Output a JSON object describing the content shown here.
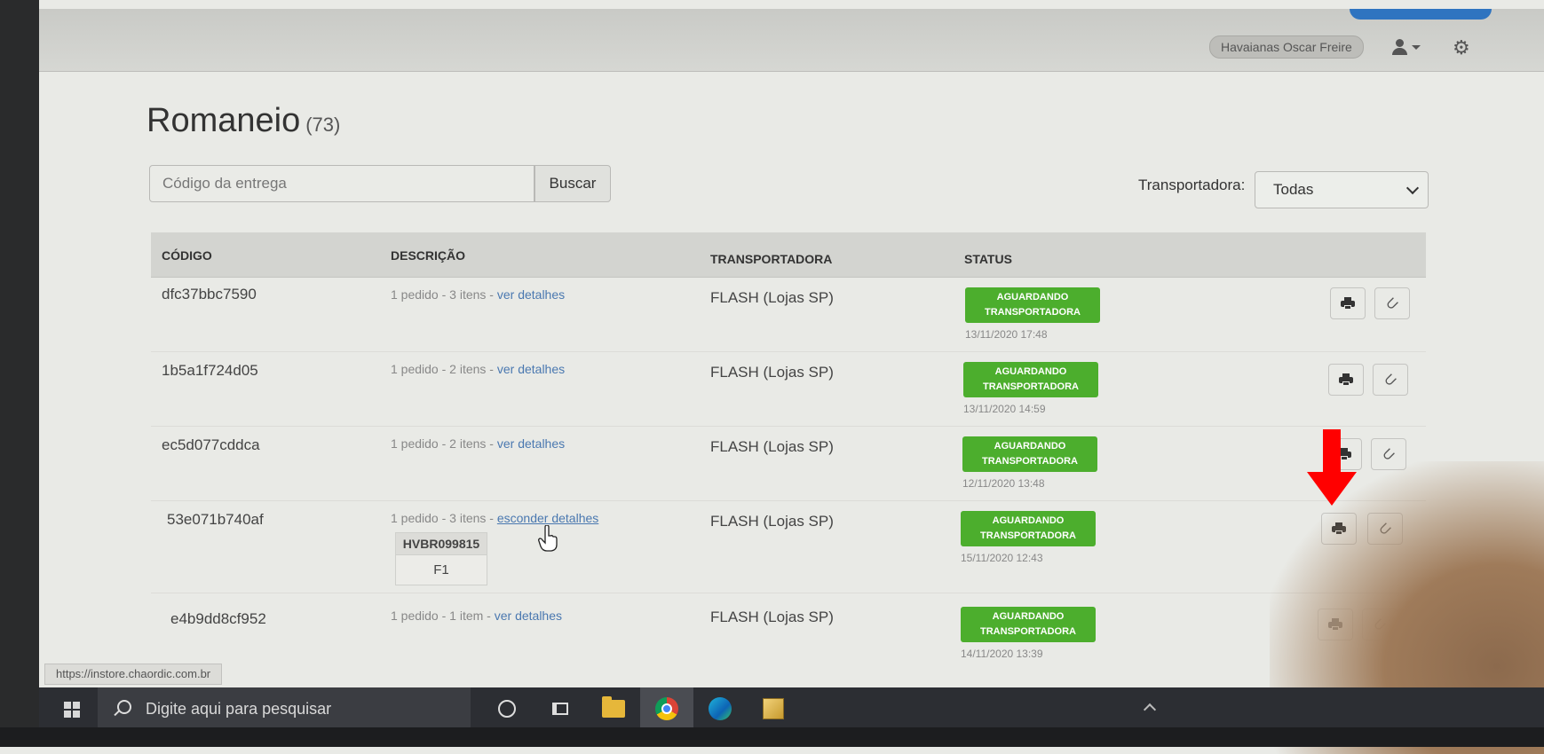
{
  "header": {
    "store_name": "Havaianas Oscar Freire",
    "user_icon": "user-icon",
    "settings_icon": "gear-icon"
  },
  "page": {
    "title": "Romaneio",
    "count": "(73)"
  },
  "search": {
    "placeholder": "Código da entrega",
    "button_label": "Buscar"
  },
  "filter": {
    "label": "Transportadora:",
    "selected": "Todas"
  },
  "table": {
    "columns": [
      "CÓDIGO",
      "DESCRIÇÃO",
      "TRANSPORTADORA",
      "STATUS"
    ],
    "rows": [
      {
        "code": "dfc37bbc7590",
        "desc": "1 pedido - 3 itens - ",
        "link": "ver detalhes",
        "carrier": "FLASH (Lojas SP)",
        "status_line1": "AGUARDANDO",
        "status_line2": "TRANSPORTADORA",
        "date": "13/11/2020 17:48"
      },
      {
        "code": "1b5a1f724d05",
        "desc": "1 pedido - 2 itens - ",
        "link": "ver detalhes",
        "carrier": "FLASH (Lojas SP)",
        "status_line1": "AGUARDANDO",
        "status_line2": "TRANSPORTADORA",
        "date": "13/11/2020 14:59"
      },
      {
        "code": "ec5d077cddca",
        "desc": "1 pedido - 2 itens - ",
        "link": "ver detalhes",
        "carrier": "FLASH (Lojas SP)",
        "status_line1": "AGUARDANDO",
        "status_line2": "TRANSPORTADORA",
        "date": "12/11/2020 13:48"
      },
      {
        "code": "53e071b740af",
        "desc": "1 pedido - 3 itens - ",
        "link": "esconder detalhes",
        "carrier": "FLASH (Lojas SP)",
        "status_line1": "AGUARDANDO",
        "status_line2": "TRANSPORTADORA",
        "date": "15/11/2020 12:43",
        "detail_code": "HVBR099815",
        "detail_sub": "F1"
      },
      {
        "code": "e4b9dd8cf952",
        "desc": "1 pedido - 1 item - ",
        "link": "ver detalhes",
        "carrier": "FLASH (Lojas SP)",
        "status_line1": "AGUARDANDO",
        "status_line2": "TRANSPORTADORA",
        "date": "14/11/2020 13:39"
      }
    ]
  },
  "statusbar": {
    "url": "https://instore.chaordic.com.br"
  },
  "taskbar": {
    "search_placeholder": "Digite aqui para pesquisar"
  },
  "colors": {
    "status_green": "#4cae2d",
    "link_blue": "#4a78b0",
    "annotation_arrow": "#ff0000"
  }
}
